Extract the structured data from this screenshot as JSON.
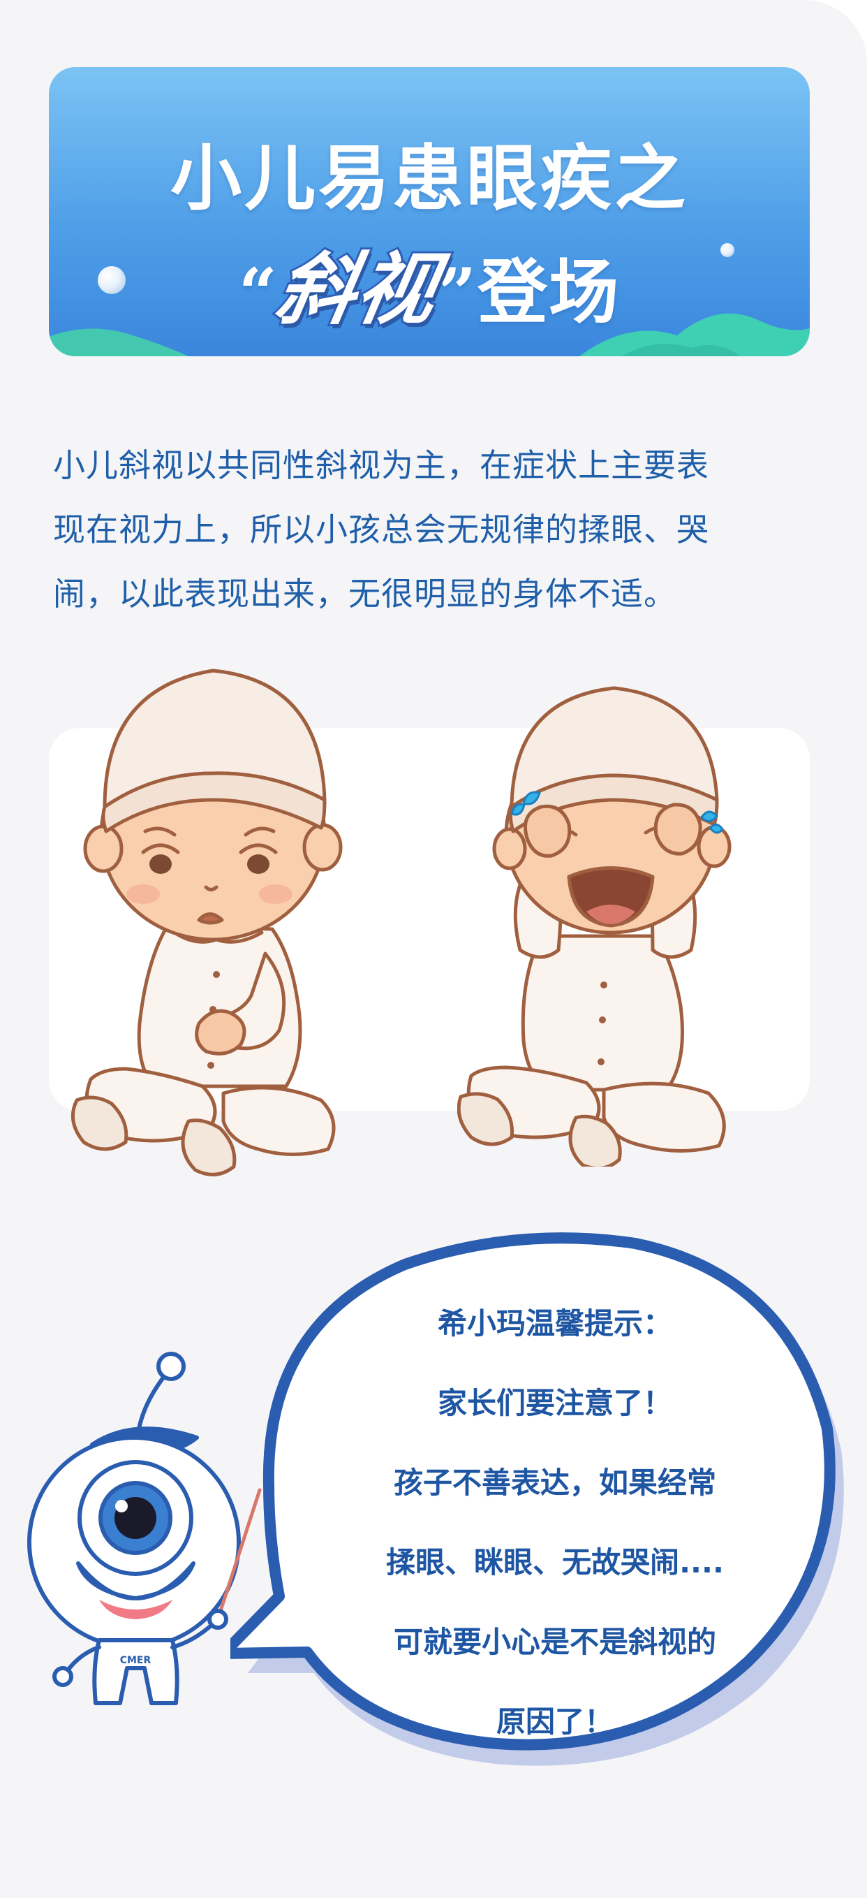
{
  "header": {
    "title_line1": "小儿易患眼疾之",
    "quote_open": "“",
    "title_emphasis": "斜视",
    "quote_close": "”",
    "title_tail": "登场"
  },
  "intro": {
    "lines": [
      "小儿斜视以共同性斜视为主，在症状上主要表",
      "现在视力上，所以小孩总会无规律的揉眼、哭",
      "闹，以此表现出来，无很明显的身体不适。"
    ]
  },
  "mascot": {
    "badge": "CMER"
  },
  "tips": {
    "lines": [
      "希小玛温馨提示：",
      "家长们要注意了！",
      "孩子不善表达，如果经常",
      "揉眼、眯眼、无故哭闹....",
      "可就要小心是不是斜视的",
      "原因了！"
    ]
  },
  "colors": {
    "accent_blue": "#1f5fa9",
    "banner_top": "#7cc3f5",
    "banner_bottom": "#3a86dd",
    "hill_green": "#3fd0b4",
    "bubble_border": "#2a5db0"
  }
}
